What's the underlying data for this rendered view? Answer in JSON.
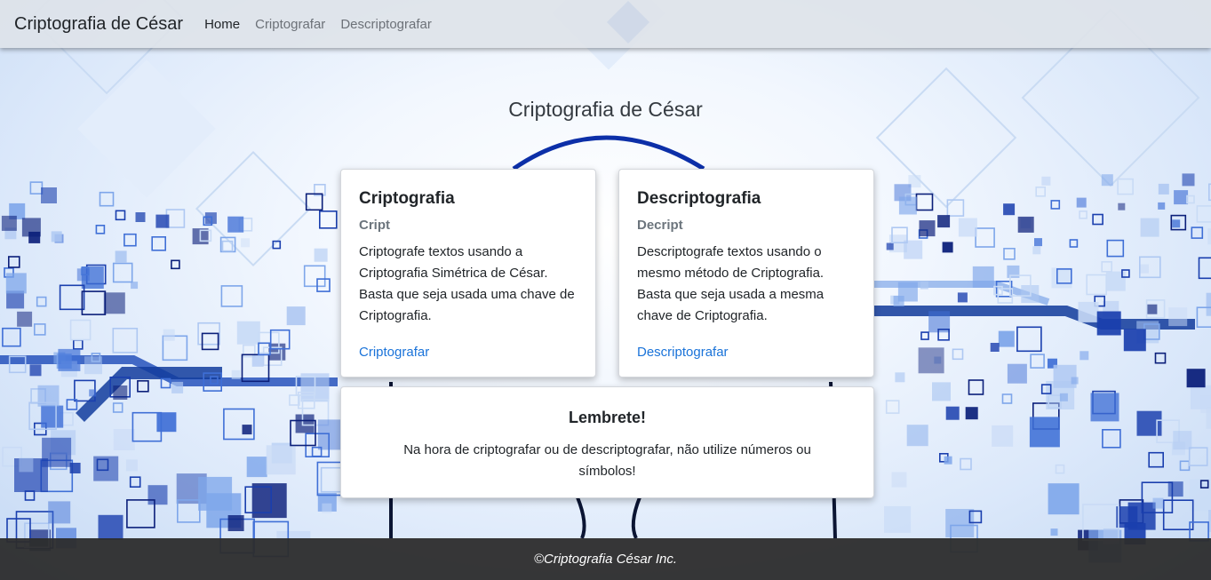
{
  "navbar": {
    "brand": "Criptografia de César",
    "links": [
      {
        "label": "Home",
        "active": true
      },
      {
        "label": "Criptografar",
        "active": false
      },
      {
        "label": "Descriptografar",
        "active": false
      }
    ]
  },
  "main": {
    "title": "Criptografia de César",
    "cards": [
      {
        "title": "Criptografia",
        "subtitle": "Cript",
        "text": "Criptografe textos usando a Criptografia Simétrica de César. Basta que seja usada uma chave de Criptografia.",
        "link": "Criptografar"
      },
      {
        "title": "Descriptografia",
        "subtitle": "Decript",
        "text": "Descriptografe textos usando o mesmo método de Criptografia. Basta que seja usada a mesma chave de Criptografia.",
        "link": "Descriptografar"
      }
    ],
    "reminder": {
      "title": "Lembrete!",
      "text": "Na hora de criptografar ou de descriptografar, não utilize números ou símbolos!"
    }
  },
  "footer": {
    "text": "©Criptografia César Inc."
  },
  "colors": {
    "accent": "#1a73d9",
    "footer_bg": "#2c2c2c",
    "navbar_bg": "#dee2e8"
  }
}
